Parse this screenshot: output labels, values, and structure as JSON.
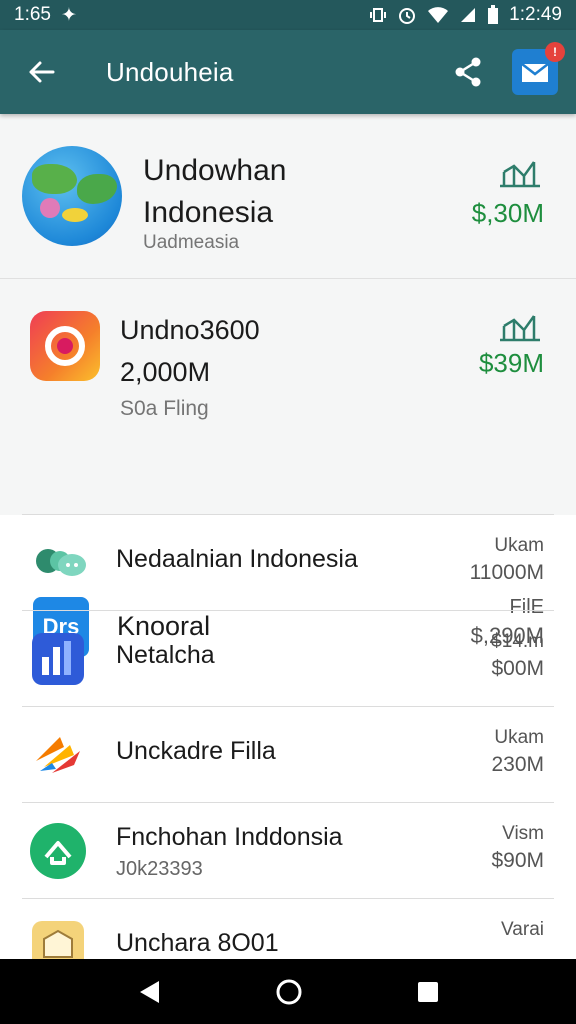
{
  "status_bar": {
    "time": "1:65",
    "clock": "1:2:49"
  },
  "app_bar": {
    "title": "Undouheia",
    "mail_badge": "!"
  },
  "hero": {
    "title": "Undowhan\nIndonesia",
    "subtitle": "Uadmeasia",
    "amount": "$,30M"
  },
  "featured": {
    "title": "Undno3600\n2,000M",
    "subtitle": "S0a Fling",
    "amount": "$39M",
    "dfs_icon_text": "Drs",
    "second_label": "Knooral",
    "second_top": "FilE",
    "second_bottom": "$,290M"
  },
  "list": [
    {
      "title": "Nedaalnian Indonesia",
      "sub": "",
      "top": "Ukam",
      "bottom": "11000M",
      "icon": "chat-bubbles-icon"
    },
    {
      "title": "Netalcha",
      "sub": "",
      "top": "$14.m",
      "bottom": "$00M",
      "icon": "bar-chart-app-icon"
    },
    {
      "title": "Unckadre Filla",
      "sub": "",
      "top": "Ukam",
      "bottom": "230M",
      "icon": "arrows-logo-icon"
    },
    {
      "title": "Fnchohan Inddonsia",
      "sub": "J0k23393",
      "top": "Vism",
      "bottom": "$90M",
      "icon": "home-arrow-icon"
    },
    {
      "title": "Unchara 8O01",
      "sub": "",
      "top": "Varai",
      "bottom": "",
      "icon": "building-icon"
    }
  ],
  "colors": {
    "app_bar": "#2a6468",
    "accent_green": "#1e8e3e",
    "mail_button": "#1f7fd1"
  }
}
